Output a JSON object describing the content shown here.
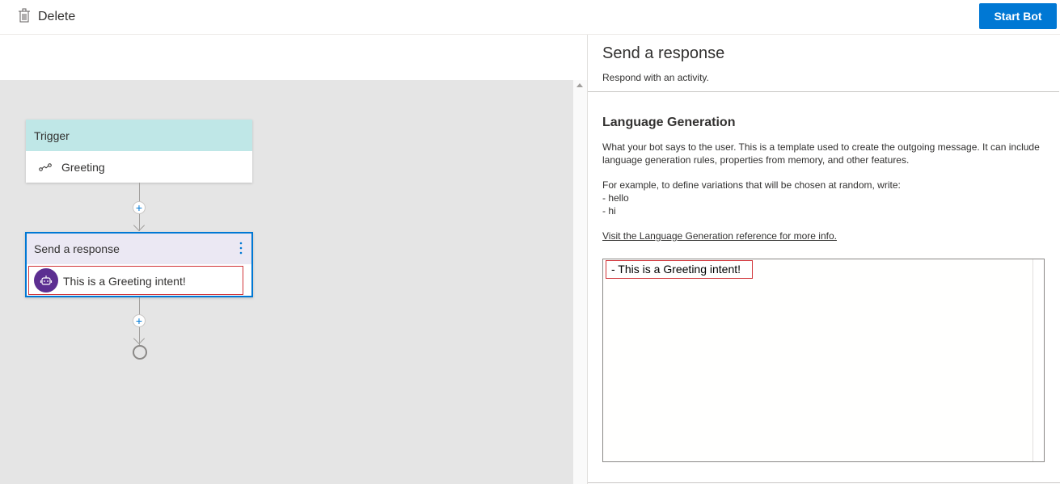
{
  "toolbar": {
    "delete_label": "Delete",
    "start_bot_label": "Start Bot"
  },
  "canvas": {
    "trigger": {
      "header": "Trigger",
      "item": "Greeting"
    },
    "response": {
      "header": "Send a response",
      "text": "This is a Greeting intent!"
    }
  },
  "panel": {
    "title": "Send a response",
    "subtitle": "Respond with an activity.",
    "section_title": "Language Generation",
    "description": "What your bot says to the user. This is a template used to create the outgoing message. It can include language generation rules, properties from memory, and other features.",
    "example_intro": "For example, to define variations that will be chosen at random, write:",
    "example_line1": "- hello",
    "example_line2": "- hi",
    "link": "Visit the Language Generation reference for more info.",
    "editor_text": "- This is a Greeting intent!"
  },
  "colors": {
    "accent": "#0078d4",
    "trigger_header": "#bfe7e7",
    "response_header": "#ebe8f3",
    "bot_avatar": "#5c2e91",
    "highlight": "#d13438",
    "canvas_bg": "#e5e5e5"
  },
  "icons": {
    "delete": "trash-icon",
    "trigger_item": "intent-icon",
    "more": "more-vertical-icon",
    "bot": "bot-icon"
  }
}
